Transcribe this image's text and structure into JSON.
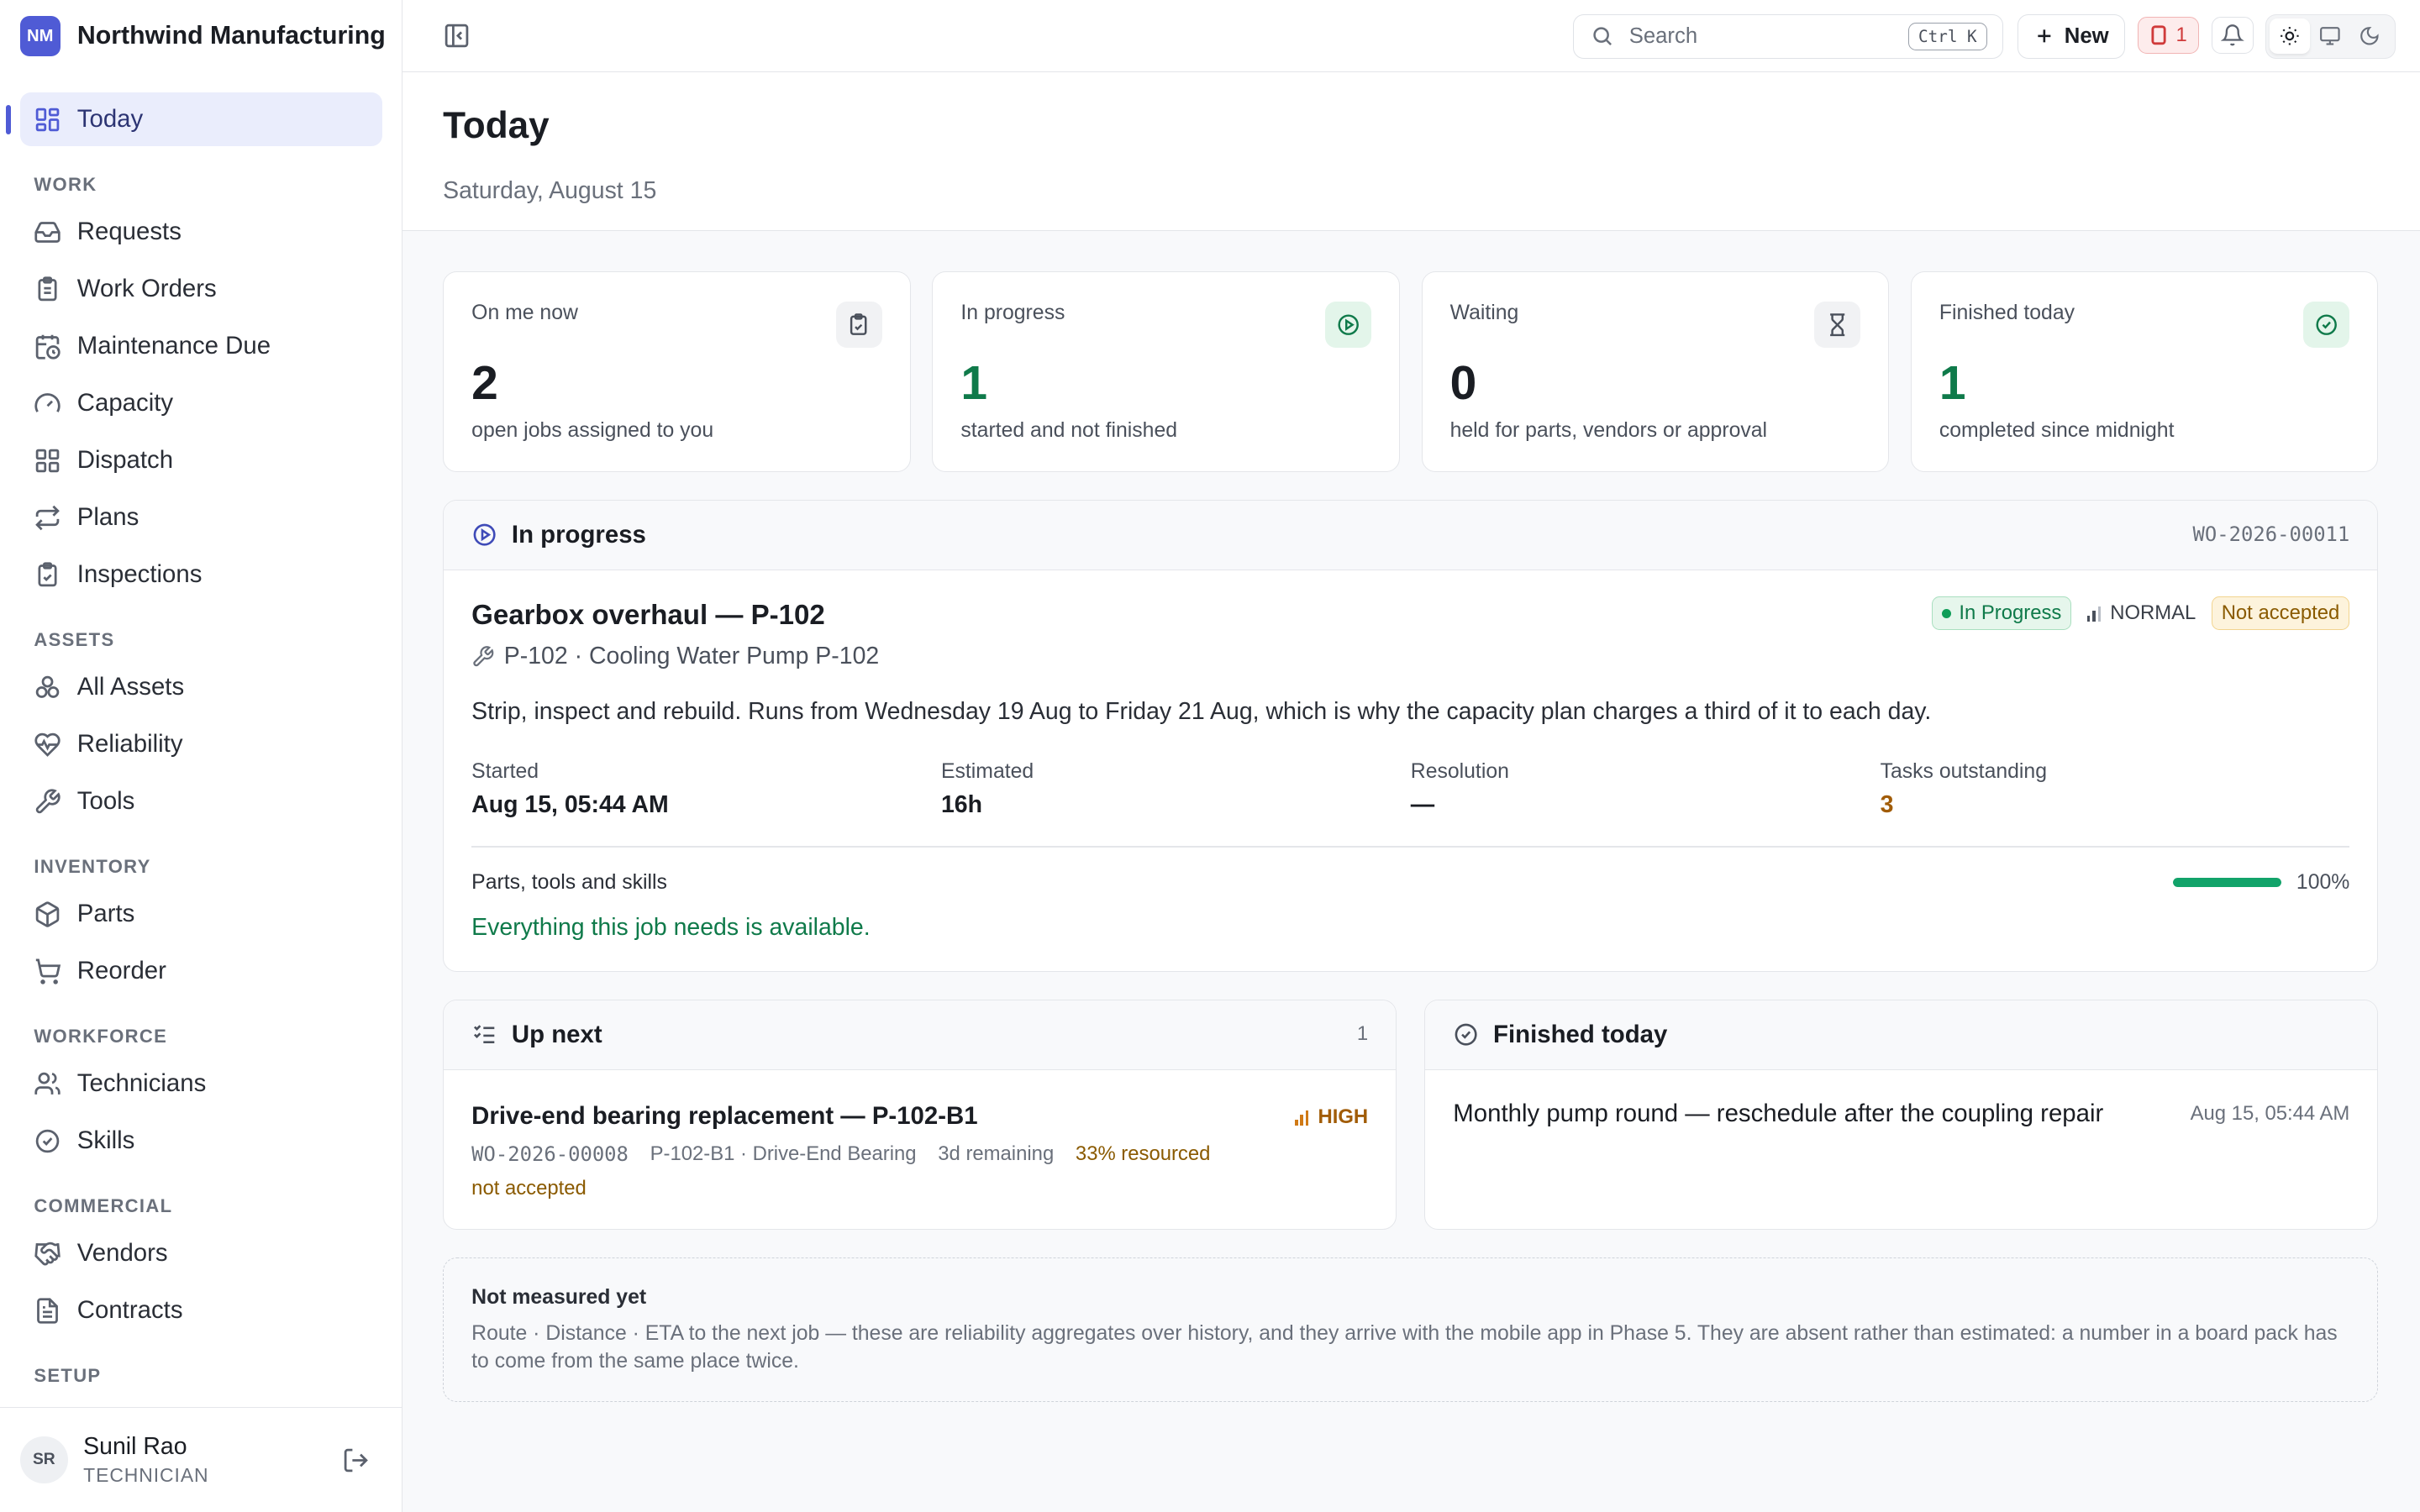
{
  "brand": {
    "initials": "NM",
    "name": "Northwind Manufacturing"
  },
  "nav": {
    "today": "Today",
    "sections": {
      "work": "WORK",
      "assets": "ASSETS",
      "inventory": "INVENTORY",
      "workforce": "WORKFORCE",
      "commercial": "COMMERCIAL",
      "setup": "SETUP"
    },
    "work": [
      "Requests",
      "Work Orders",
      "Maintenance Due",
      "Capacity",
      "Dispatch",
      "Plans",
      "Inspections"
    ],
    "assets": [
      "All Assets",
      "Reliability",
      "Tools"
    ],
    "inventory": [
      "Parts",
      "Reorder"
    ],
    "workforce": [
      "Technicians",
      "Skills"
    ],
    "commercial": [
      "Vendors",
      "Contracts"
    ]
  },
  "user": {
    "initials": "SR",
    "name": "Sunil Rao",
    "role": "TECHNICIAN"
  },
  "topbar": {
    "search_placeholder": "Search",
    "search_shortcut": "Ctrl K",
    "new_label": "New",
    "alert_count": "1"
  },
  "page": {
    "title": "Today",
    "date": "Saturday, August 15"
  },
  "stats": [
    {
      "label": "On me now",
      "value": "2",
      "sub": "open jobs assigned to you",
      "icon": "clipboard-check-icon"
    },
    {
      "label": "In progress",
      "value": "1",
      "sub": "started and not finished",
      "icon": "play-circle-icon"
    },
    {
      "label": "Waiting",
      "value": "0",
      "sub": "held for parts, vendors or approval",
      "icon": "hourglass-icon"
    },
    {
      "label": "Finished today",
      "value": "1",
      "sub": "completed since midnight",
      "icon": "check-circle-icon"
    }
  ],
  "in_progress": {
    "heading": "In progress",
    "wo_number": "WO-2026-00011",
    "title": "Gearbox overhaul — P-102",
    "asset": "P-102 · Cooling Water Pump P-102",
    "status": "In Progress",
    "priority": "NORMAL",
    "acceptance": "Not accepted",
    "description": "Strip, inspect and rebuild. Runs from Wednesday 19 Aug to Friday 21 Aug, which is why the capacity plan charges a third of it to each day.",
    "metrics": [
      {
        "label": "Started",
        "value": "Aug 15, 05:44 AM"
      },
      {
        "label": "Estimated",
        "value": "16h"
      },
      {
        "label": "Resolution",
        "value": "—"
      },
      {
        "label": "Tasks outstanding",
        "value": "3"
      }
    ],
    "parts_label": "Parts, tools and skills",
    "parts_status": "Everything this job needs is available.",
    "parts_percent": 100,
    "parts_percent_label": "100%"
  },
  "up_next": {
    "heading": "Up next",
    "count": "1",
    "title": "Drive-end bearing replacement — P-102-B1",
    "priority": "HIGH",
    "wo_number": "WO-2026-00008",
    "asset": "P-102-B1 · Drive-End Bearing",
    "remaining": "3d remaining",
    "resourced": "33% resourced",
    "acceptance": "not accepted"
  },
  "finished_today": {
    "heading": "Finished today",
    "title": "Monthly pump round — reschedule after the coupling repair",
    "time": "Aug 15, 05:44 AM"
  },
  "note": {
    "title": "Not measured yet",
    "body": "Route · Distance · ETA to the next job — these are reliability aggregates over history, and they arrive with the mobile app in Phase 5. They are absent rather than estimated: a number in a board pack has to come from the same place twice."
  },
  "colors": {
    "accent": "#4f5bd5",
    "success": "#0f7a4a",
    "warning": "#a15c07",
    "danger": "#d03a3a"
  }
}
